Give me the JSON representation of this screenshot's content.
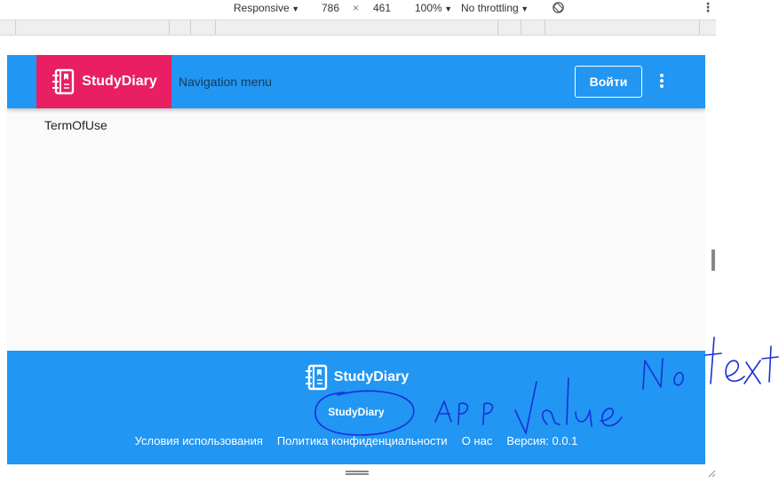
{
  "devtools": {
    "device": "Responsive",
    "width": "786",
    "times": "×",
    "height": "461",
    "zoom": "100%",
    "throttling": "No throttling"
  },
  "header": {
    "brand": "StudyDiary",
    "nav_text": "Navigation menu",
    "login_label": "Войти"
  },
  "content": {
    "text": "TermOfUse"
  },
  "footer": {
    "brand": "StudyDiary",
    "app_name": "StudyDiary",
    "links": [
      "Условия использования",
      "Политика конфиденциальности",
      "О нас"
    ],
    "version": "Версия: 0.0.1"
  },
  "colors": {
    "primary": "#2196f3",
    "accent": "#e91e63",
    "annotation": "#1a2fd6"
  },
  "icons": {
    "brand": "diary-book-icon",
    "more": "more-vertical-icon",
    "rotate": "rotate-icon"
  },
  "handwritten_notes": [
    "App value",
    "No text"
  ]
}
